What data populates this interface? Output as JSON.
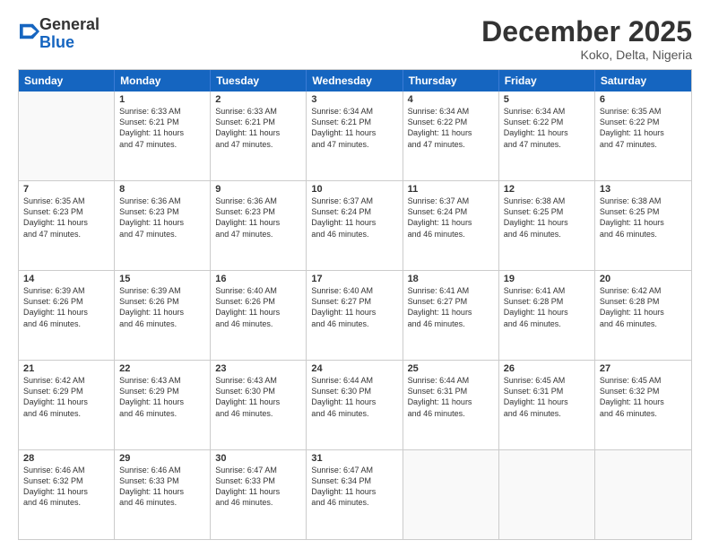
{
  "logo": {
    "general": "General",
    "blue": "Blue"
  },
  "header": {
    "month": "December 2025",
    "location": "Koko, Delta, Nigeria"
  },
  "days": [
    "Sunday",
    "Monday",
    "Tuesday",
    "Wednesday",
    "Thursday",
    "Friday",
    "Saturday"
  ],
  "weeks": [
    [
      {
        "day": "",
        "info": ""
      },
      {
        "day": "1",
        "info": "Sunrise: 6:33 AM\nSunset: 6:21 PM\nDaylight: 11 hours\nand 47 minutes."
      },
      {
        "day": "2",
        "info": "Sunrise: 6:33 AM\nSunset: 6:21 PM\nDaylight: 11 hours\nand 47 minutes."
      },
      {
        "day": "3",
        "info": "Sunrise: 6:34 AM\nSunset: 6:21 PM\nDaylight: 11 hours\nand 47 minutes."
      },
      {
        "day": "4",
        "info": "Sunrise: 6:34 AM\nSunset: 6:22 PM\nDaylight: 11 hours\nand 47 minutes."
      },
      {
        "day": "5",
        "info": "Sunrise: 6:34 AM\nSunset: 6:22 PM\nDaylight: 11 hours\nand 47 minutes."
      },
      {
        "day": "6",
        "info": "Sunrise: 6:35 AM\nSunset: 6:22 PM\nDaylight: 11 hours\nand 47 minutes."
      }
    ],
    [
      {
        "day": "7",
        "info": "Sunrise: 6:35 AM\nSunset: 6:23 PM\nDaylight: 11 hours\nand 47 minutes."
      },
      {
        "day": "8",
        "info": "Sunrise: 6:36 AM\nSunset: 6:23 PM\nDaylight: 11 hours\nand 47 minutes."
      },
      {
        "day": "9",
        "info": "Sunrise: 6:36 AM\nSunset: 6:23 PM\nDaylight: 11 hours\nand 47 minutes."
      },
      {
        "day": "10",
        "info": "Sunrise: 6:37 AM\nSunset: 6:24 PM\nDaylight: 11 hours\nand 46 minutes."
      },
      {
        "day": "11",
        "info": "Sunrise: 6:37 AM\nSunset: 6:24 PM\nDaylight: 11 hours\nand 46 minutes."
      },
      {
        "day": "12",
        "info": "Sunrise: 6:38 AM\nSunset: 6:25 PM\nDaylight: 11 hours\nand 46 minutes."
      },
      {
        "day": "13",
        "info": "Sunrise: 6:38 AM\nSunset: 6:25 PM\nDaylight: 11 hours\nand 46 minutes."
      }
    ],
    [
      {
        "day": "14",
        "info": "Sunrise: 6:39 AM\nSunset: 6:26 PM\nDaylight: 11 hours\nand 46 minutes."
      },
      {
        "day": "15",
        "info": "Sunrise: 6:39 AM\nSunset: 6:26 PM\nDaylight: 11 hours\nand 46 minutes."
      },
      {
        "day": "16",
        "info": "Sunrise: 6:40 AM\nSunset: 6:26 PM\nDaylight: 11 hours\nand 46 minutes."
      },
      {
        "day": "17",
        "info": "Sunrise: 6:40 AM\nSunset: 6:27 PM\nDaylight: 11 hours\nand 46 minutes."
      },
      {
        "day": "18",
        "info": "Sunrise: 6:41 AM\nSunset: 6:27 PM\nDaylight: 11 hours\nand 46 minutes."
      },
      {
        "day": "19",
        "info": "Sunrise: 6:41 AM\nSunset: 6:28 PM\nDaylight: 11 hours\nand 46 minutes."
      },
      {
        "day": "20",
        "info": "Sunrise: 6:42 AM\nSunset: 6:28 PM\nDaylight: 11 hours\nand 46 minutes."
      }
    ],
    [
      {
        "day": "21",
        "info": "Sunrise: 6:42 AM\nSunset: 6:29 PM\nDaylight: 11 hours\nand 46 minutes."
      },
      {
        "day": "22",
        "info": "Sunrise: 6:43 AM\nSunset: 6:29 PM\nDaylight: 11 hours\nand 46 minutes."
      },
      {
        "day": "23",
        "info": "Sunrise: 6:43 AM\nSunset: 6:30 PM\nDaylight: 11 hours\nand 46 minutes."
      },
      {
        "day": "24",
        "info": "Sunrise: 6:44 AM\nSunset: 6:30 PM\nDaylight: 11 hours\nand 46 minutes."
      },
      {
        "day": "25",
        "info": "Sunrise: 6:44 AM\nSunset: 6:31 PM\nDaylight: 11 hours\nand 46 minutes."
      },
      {
        "day": "26",
        "info": "Sunrise: 6:45 AM\nSunset: 6:31 PM\nDaylight: 11 hours\nand 46 minutes."
      },
      {
        "day": "27",
        "info": "Sunrise: 6:45 AM\nSunset: 6:32 PM\nDaylight: 11 hours\nand 46 minutes."
      }
    ],
    [
      {
        "day": "28",
        "info": "Sunrise: 6:46 AM\nSunset: 6:32 PM\nDaylight: 11 hours\nand 46 minutes."
      },
      {
        "day": "29",
        "info": "Sunrise: 6:46 AM\nSunset: 6:33 PM\nDaylight: 11 hours\nand 46 minutes."
      },
      {
        "day": "30",
        "info": "Sunrise: 6:47 AM\nSunset: 6:33 PM\nDaylight: 11 hours\nand 46 minutes."
      },
      {
        "day": "31",
        "info": "Sunrise: 6:47 AM\nSunset: 6:34 PM\nDaylight: 11 hours\nand 46 minutes."
      },
      {
        "day": "",
        "info": ""
      },
      {
        "day": "",
        "info": ""
      },
      {
        "day": "",
        "info": ""
      }
    ]
  ]
}
